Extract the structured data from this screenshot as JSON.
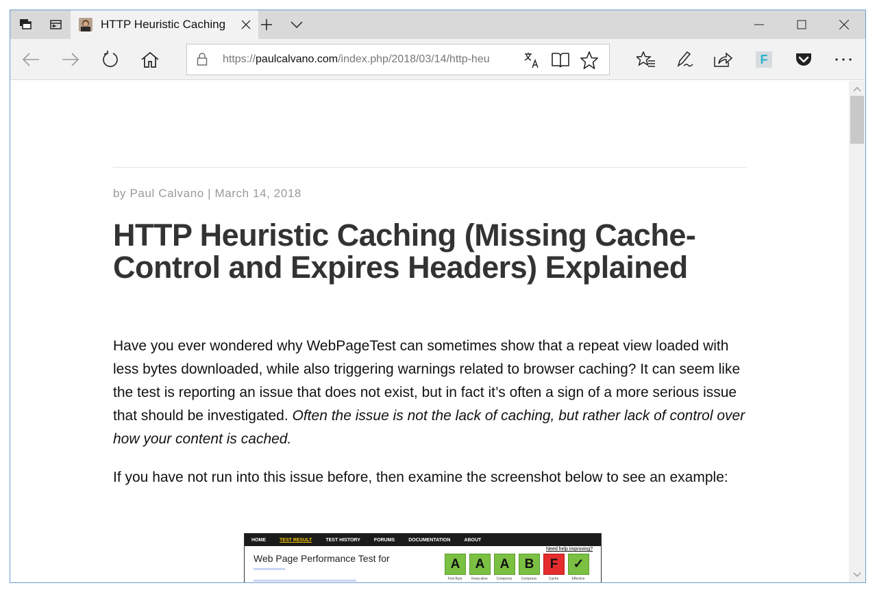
{
  "browser": {
    "tab": {
      "title": "HTTP Heuristic Caching"
    },
    "address": {
      "url_prefix": "https://",
      "url_domain": "paulcalvano.com",
      "url_path": "/index.php/2018/03/14/http-heu"
    },
    "icons": {
      "tab_actions": "tab-actions-icon",
      "tabs_aside": "set-aside-tabs-icon",
      "tab_favicon": "author-avatar-icon",
      "tab_close": "close-icon",
      "new_tab": "plus-icon",
      "tab_preview": "chevron-down-icon",
      "minimize": "minimize-icon",
      "maximize": "maximize-icon",
      "window_close": "close-icon",
      "back": "back-arrow-icon",
      "forward": "forward-arrow-icon",
      "refresh": "refresh-icon",
      "home": "home-icon",
      "lock": "lock-icon",
      "translate": "translate-icon",
      "reading_view": "reading-view-icon",
      "favorite": "star-icon",
      "favorites_hub": "favorites-list-icon",
      "web_note": "pen-icon",
      "share": "share-icon",
      "extension_f": "extension-f-icon",
      "pocket": "pocket-icon",
      "more": "more-icon"
    },
    "extension_f_letter": "F"
  },
  "article": {
    "byline": "by Paul Calvano | March 14, 2018",
    "title": "HTTP Heuristic Caching (Missing Cache-Control and Expires Headers) Explained",
    "paragraph1_text": "Have you ever wondered why WebPageTest can sometimes show that a repeat view loaded with less bytes downloaded, while also triggering warnings related to browser caching? It can seem like the test is reporting an issue that does not exist, but in fact it’s often a sign of a more serious issue that should be investigated. ",
    "paragraph1_emphasis": "Often the issue is not the lack of caching, but rather lack of control over how your content is cached.",
    "paragraph2": "If you have not run into this issue before, then examine the screenshot below to see an example:"
  },
  "screenshot": {
    "menu": [
      "HOME",
      "TEST RESULT",
      "TEST HISTORY",
      "FORUMS",
      "DOCUMENTATION",
      "ABOUT"
    ],
    "title": "Web Page Performance Test for",
    "help_link": "Need help improving?",
    "grades": [
      {
        "grade": "A",
        "label": "First Byte"
      },
      {
        "grade": "A",
        "label": "Keep-alive"
      },
      {
        "grade": "A",
        "label": "Compress"
      },
      {
        "grade": "B",
        "label": "Compress"
      },
      {
        "grade": "F",
        "label": "Cache"
      },
      {
        "grade": "✓",
        "label": "Effective"
      }
    ],
    "colors": {
      "good": "#7bc043",
      "bad": "#e52d2d"
    }
  }
}
